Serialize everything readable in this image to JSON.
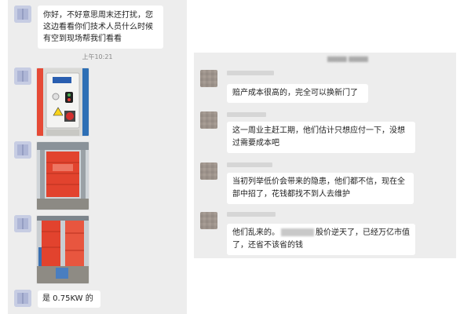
{
  "left_chat": {
    "messages": [
      {
        "text": "你好，不好意思周末还打扰，您这边看看你们技术人员什么时候有空到现场帮我们看看"
      },
      {
        "text": "是 0.75KW 的"
      }
    ],
    "timestamp": "上午10:21",
    "photos": [
      {
        "icon": "control-box-photo"
      },
      {
        "icon": "rapid-door-photo"
      },
      {
        "icon": "rapid-door-site-photo"
      }
    ]
  },
  "right_chat": {
    "messages": [
      {
        "text": "赔产成本很高的，完全可以换新门了"
      },
      {
        "text": "这一周业主赶工期，他们估计只想应付一下，没想过需要成本吧"
      },
      {
        "text": "当初列举低价会带来的隐患，他们都不信，现在全部中招了，花钱都找不到人去维护"
      },
      {
        "text_before": "他们乱来的。",
        "text_after": "股价逆天了，已经万亿市值了，还省不该省的钱"
      }
    ]
  },
  "colors": {
    "chat_bg": "#ededed",
    "bubble_bg": "#ffffff",
    "door_red": "#e2432e"
  }
}
